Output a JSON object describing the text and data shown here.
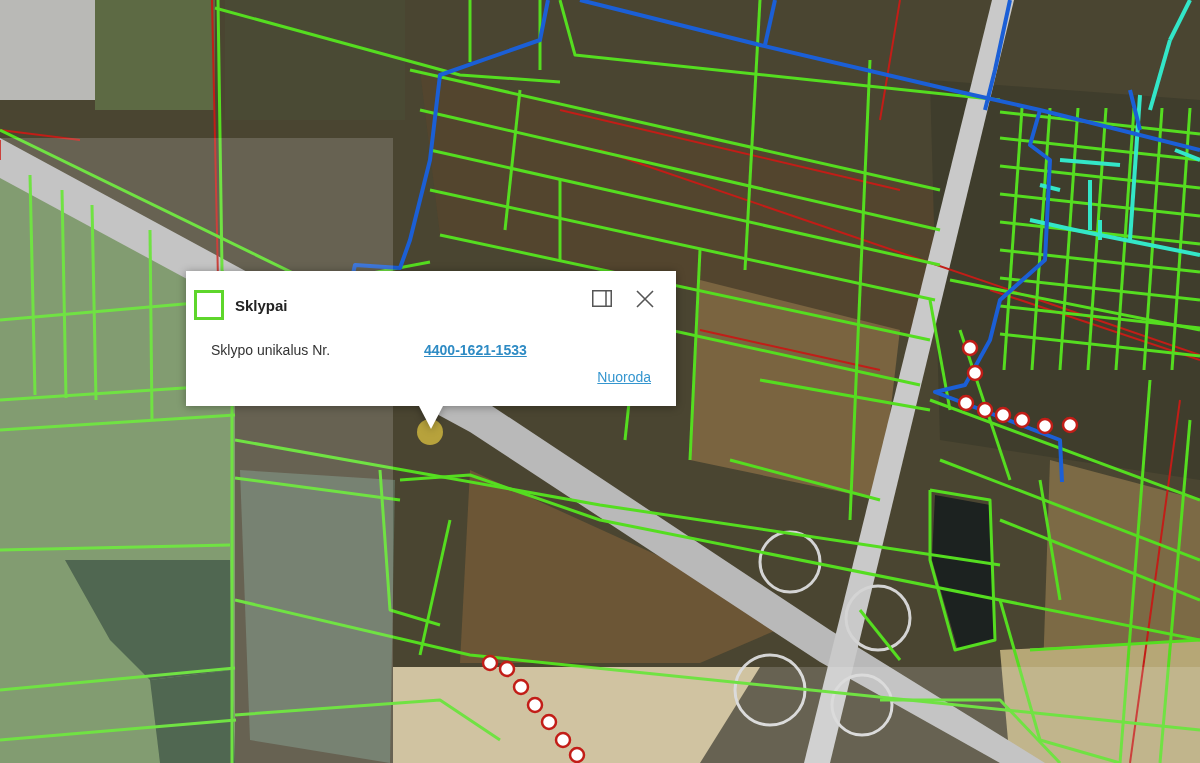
{
  "popup": {
    "layer_title": "Sklypai",
    "attributes": [
      {
        "label": "Sklypo unikalus Nr.",
        "value": "4400-1621-1533"
      }
    ],
    "link": "Nuoroda"
  }
}
